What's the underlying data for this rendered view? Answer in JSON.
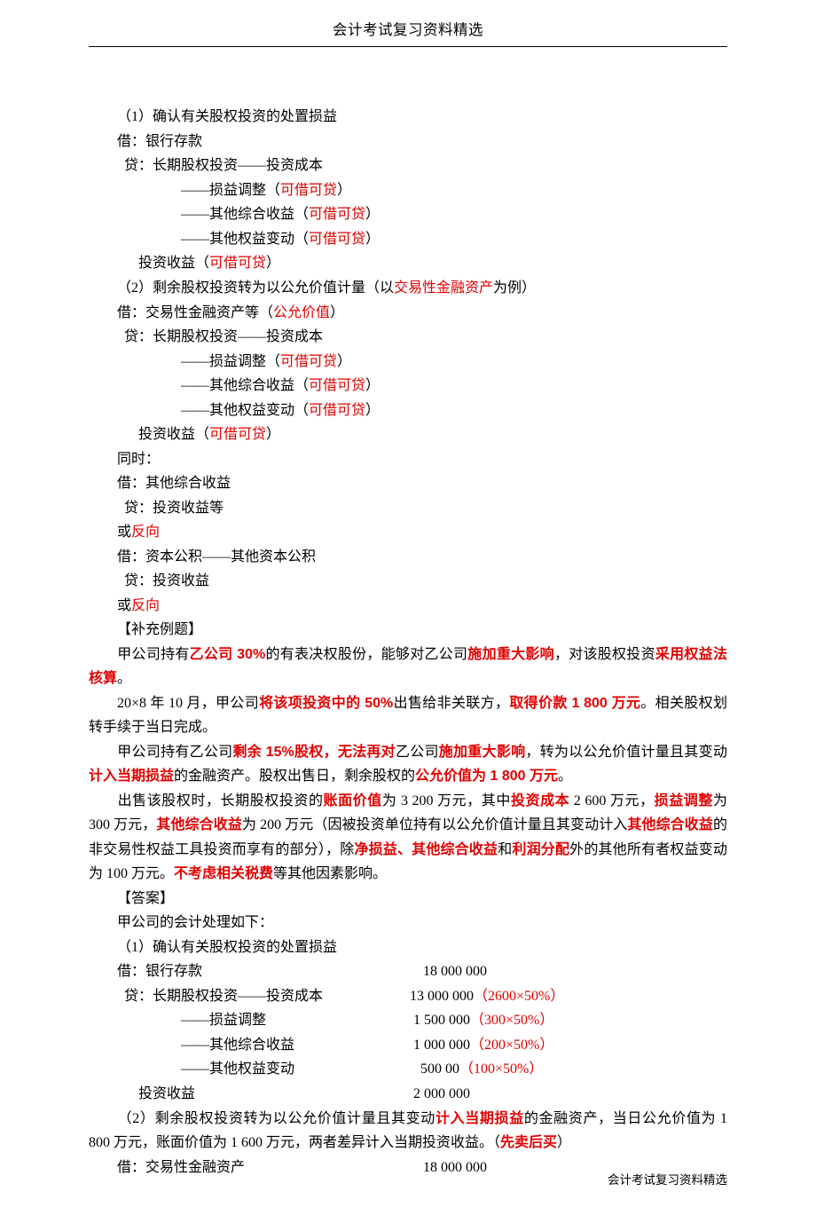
{
  "header": {
    "title": "会计考试复习资料精选"
  },
  "footer": {
    "text": "会计考试复习资料精选"
  },
  "section1": {
    "title": "（1）确认有关股权投资的处置损益",
    "l1": "借：银行存款",
    "l2a": "  贷：长期股权投资——投资成本",
    "l3a": "                  ——损益调整（",
    "l3b": "可借可贷",
    "l3c": "）",
    "l4a": "                  ——其他综合收益（",
    "l4b": "可借可贷",
    "l4c": "）",
    "l5a": "                  ——其他权益变动（",
    "l5b": "可借可贷",
    "l5c": "）",
    "l6a": "      投资收益（",
    "l6b": "可借可贷",
    "l6c": "）"
  },
  "section2": {
    "titleA": "（2）剩余股权投资转为以公允价值计量（以",
    "titleB": "交易性金融资产",
    "titleC": "为例）",
    "l1a": "借：交易性金融资产等（",
    "l1b": "公允价值",
    "l1c": "）",
    "l2": "  贷：长期股权投资——投资成本",
    "l3a": "                  ——损益调整（",
    "l3b": "可借可贷",
    "l3c": "）",
    "l4a": "                  ——其他综合收益（",
    "l4b": "可借可贷",
    "l4c": "）",
    "l5a": "                  ——其他权益变动（",
    "l5b": "可借可贷",
    "l5c": "）",
    "l6a": "      投资收益（",
    "l6b": "可借可贷",
    "l6c": "）",
    "l7": "同时：",
    "l8": "借：其他综合收益",
    "l9": "  贷：投资收益等",
    "l10a": "或",
    "l10b": "反向",
    "l11": "借：资本公积——其他资本公积",
    "l12": "  贷：投资收益",
    "l13a": "或",
    "l13b": "反向"
  },
  "example": {
    "title": "【补充例题】",
    "p1a": "甲公司持有",
    "p1b": "乙公司 30%",
    "p1c": "的有表决权股份，能够对乙公司",
    "p1d": "施加重大影响",
    "p1e": "，对该股权投资",
    "p1f": "采用权益法核算",
    "p1g": "。",
    "p2a": "20×8 年 10 月，甲公司",
    "p2b": "将该项投资中的 50%",
    "p2c": "出售给非关联方，",
    "p2d": "取得价款 1 800 万元",
    "p2e": "。相关股权划转手续于当日完成。",
    "p3a": "甲公司持有乙公司",
    "p3b": "剩余 15%股权，无法再对",
    "p3c": "乙公司",
    "p3d": "施加重大影响",
    "p3e": "，转为以公允价值计量且其变动",
    "p3f": "计入当期损益",
    "p3g": "的金融资产。股权出售日，剩余股权的",
    "p3h": "公允价值为 1 800 万元",
    "p3i": "。",
    "p4a": "出售该股权时，长期股权投资的",
    "p4b": "账面价值",
    "p4c": "为 3 200 万元，其中",
    "p4d": "投资成本",
    "p4e": " 2 600 万元，",
    "p4f": "损益调整",
    "p4g": "为 300 万元，",
    "p4h": "其他综合收益",
    "p4i": "为 200 万元（因被投资单位持有以公允价值计量且其变动计入",
    "p4j": "其他综合收益",
    "p4k": "的非交易性权益工具投资而享有的部分），除",
    "p4l": "净损益、其他综合收益",
    "p4m": "和",
    "p4n": "利润分配",
    "p4o": "外的其他所有者权益变动为 100 万元。",
    "p4p": "不考虑相关税费",
    "p4q": "等其他因素影响。"
  },
  "answer": {
    "title": "【答案】",
    "intro": "甲公司的会计处理如下：",
    "s1title": "（1）确认有关股权投资的处置损益",
    "e1": {
      "label": "借：银行存款",
      "amount": "18 000 000"
    },
    "e2": {
      "label": "  贷：长期股权投资——投资成本",
      "amount": "13 000 000",
      "calc": "（2600×50%）"
    },
    "e3": {
      "label": "                  ——损益调整",
      "amount": " 1 500 000",
      "calc": "（300×50%）"
    },
    "e4": {
      "label": "                  ——其他综合收益",
      "amount": " 1 000 000",
      "calc": "（200×50%）"
    },
    "e5": {
      "label": "                  ——其他权益变动",
      "amount": "   500 00",
      "calc": "（100×50%）"
    },
    "e6": {
      "label": "      投资收益",
      "amount": " 2 000 000"
    },
    "s2a": "（2）剩余股权投资转为以公允价值计量且其变动",
    "s2b": "计入当期损益",
    "s2c": "的金融资产，当日公允价值为 1 800 万元，账面价值为 1 600 万元，两者差异计入当期投资收益。（",
    "s2d": "先卖后买",
    "s2e": "）",
    "e7": {
      "label": "借：交易性金融资产",
      "amount": "18 000 000"
    }
  }
}
